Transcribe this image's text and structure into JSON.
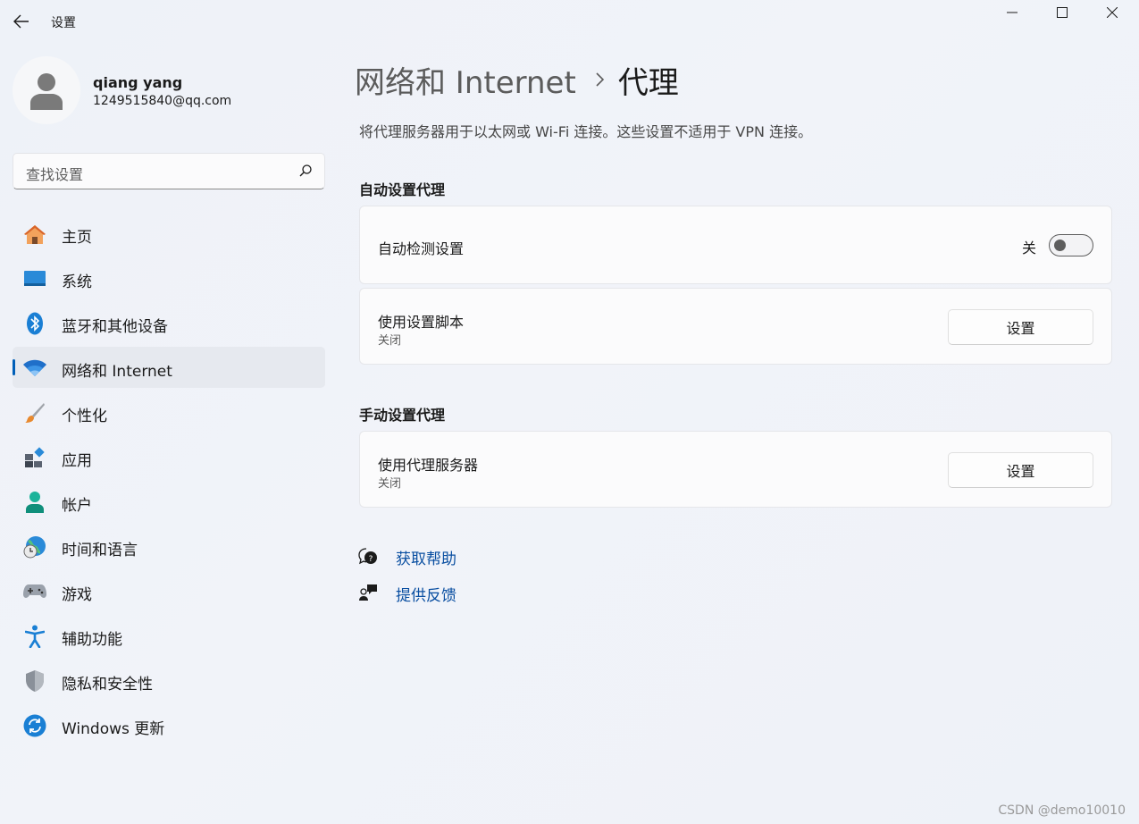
{
  "window": {
    "title": "设置"
  },
  "profile": {
    "name": "qiang yang",
    "email": "1249515840@qq.com"
  },
  "search": {
    "placeholder": "查找设置"
  },
  "sidebar": {
    "items": [
      {
        "label": "主页",
        "icon": "home-icon"
      },
      {
        "label": "系统",
        "icon": "system-icon"
      },
      {
        "label": "蓝牙和其他设备",
        "icon": "bluetooth-icon"
      },
      {
        "label": "网络和 Internet",
        "icon": "wifi-icon",
        "selected": true
      },
      {
        "label": "个性化",
        "icon": "brush-icon"
      },
      {
        "label": "应用",
        "icon": "apps-icon"
      },
      {
        "label": "帐户",
        "icon": "account-icon"
      },
      {
        "label": "时间和语言",
        "icon": "globe-clock-icon"
      },
      {
        "label": "游戏",
        "icon": "gamepad-icon"
      },
      {
        "label": "辅助功能",
        "icon": "accessibility-icon"
      },
      {
        "label": "隐私和安全性",
        "icon": "shield-icon"
      },
      {
        "label": "Windows 更新",
        "icon": "update-icon"
      }
    ]
  },
  "breadcrumb": {
    "parent": "网络和 Internet",
    "current": "代理"
  },
  "description": "将代理服务器用于以太网或 Wi-Fi 连接。这些设置不适用于 VPN 连接。",
  "auto_section": {
    "title": "自动设置代理",
    "detect": {
      "label": "自动检测设置",
      "state_label": "关",
      "on": false
    },
    "script": {
      "label": "使用设置脚本",
      "status": "关闭",
      "button": "设置"
    }
  },
  "manual_section": {
    "title": "手动设置代理",
    "proxy": {
      "label": "使用代理服务器",
      "status": "关闭",
      "button": "设置"
    }
  },
  "links": {
    "help": "获取帮助",
    "feedback": "提供反馈"
  },
  "watermark": "CSDN @demo10010",
  "colors": {
    "accent": "#005fb8",
    "link": "#0a4fa1",
    "background": "#eef2f8"
  }
}
